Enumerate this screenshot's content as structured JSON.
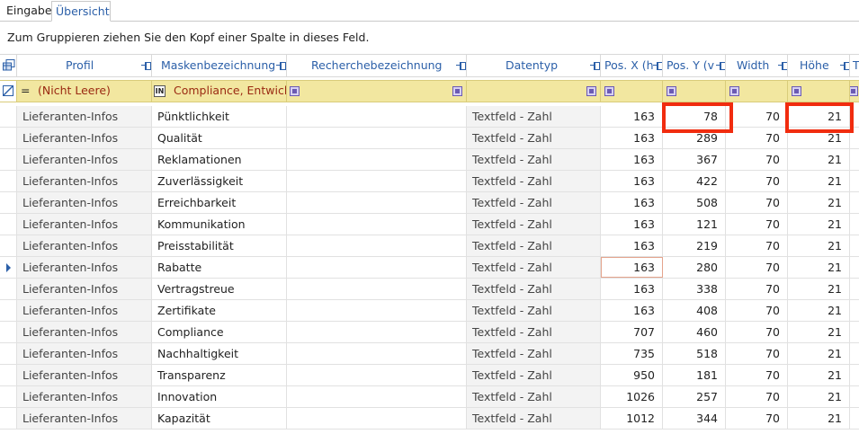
{
  "tabs": [
    {
      "label": "Eingabe",
      "active": false
    },
    {
      "label": "Übersicht",
      "active": true
    }
  ],
  "group_panel": {
    "text": "Zum Gruppieren ziehen Sie den Kopf einer Spalte in dieses Feld."
  },
  "columns": [
    {
      "label": "Profil"
    },
    {
      "label": "Maskenbezeichnung"
    },
    {
      "label": "Recherchebezeichnung"
    },
    {
      "label": "Datentyp"
    },
    {
      "label": "Pos. X (h"
    },
    {
      "label": "Pos. Y (v"
    },
    {
      "label": "Width"
    },
    {
      "label": "Höhe"
    },
    {
      "label": "T"
    }
  ],
  "filter_row": {
    "operator": "=",
    "profil": "(Nicht Leere)",
    "in_label": "IN",
    "maskenbezeichnung": "Compliance, Entwickl"
  },
  "rows": [
    {
      "profil": "Lieferanten-Infos",
      "maske": "Pünktlichkeit",
      "recherche": "",
      "datentyp": "Textfeld - Zahl",
      "x": "163",
      "y": "78",
      "w": "70",
      "h": "21"
    },
    {
      "profil": "Lieferanten-Infos",
      "maske": "Qualität",
      "recherche": "",
      "datentyp": "Textfeld - Zahl",
      "x": "163",
      "y": "289",
      "w": "70",
      "h": "21"
    },
    {
      "profil": "Lieferanten-Infos",
      "maske": "Reklamationen",
      "recherche": "",
      "datentyp": "Textfeld - Zahl",
      "x": "163",
      "y": "367",
      "w": "70",
      "h": "21"
    },
    {
      "profil": "Lieferanten-Infos",
      "maske": "Zuverlässigkeit",
      "recherche": "",
      "datentyp": "Textfeld - Zahl",
      "x": "163",
      "y": "422",
      "w": "70",
      "h": "21"
    },
    {
      "profil": "Lieferanten-Infos",
      "maske": "Erreichbarkeit",
      "recherche": "",
      "datentyp": "Textfeld - Zahl",
      "x": "163",
      "y": "508",
      "w": "70",
      "h": "21"
    },
    {
      "profil": "Lieferanten-Infos",
      "maske": "Kommunikation",
      "recherche": "",
      "datentyp": "Textfeld - Zahl",
      "x": "163",
      "y": "121",
      "w": "70",
      "h": "21"
    },
    {
      "profil": "Lieferanten-Infos",
      "maske": "Preisstabilität",
      "recherche": "",
      "datentyp": "Textfeld - Zahl",
      "x": "163",
      "y": "219",
      "w": "70",
      "h": "21"
    },
    {
      "profil": "Lieferanten-Infos",
      "maske": "Rabatte",
      "recherche": "",
      "datentyp": "Textfeld - Zahl",
      "x": "163",
      "y": "280",
      "w": "70",
      "h": "21",
      "current": true
    },
    {
      "profil": "Lieferanten-Infos",
      "maske": "Vertragstreue",
      "recherche": "",
      "datentyp": "Textfeld - Zahl",
      "x": "163",
      "y": "338",
      "w": "70",
      "h": "21"
    },
    {
      "profil": "Lieferanten-Infos",
      "maske": "Zertifikate",
      "recherche": "",
      "datentyp": "Textfeld - Zahl",
      "x": "163",
      "y": "408",
      "w": "70",
      "h": "21"
    },
    {
      "profil": "Lieferanten-Infos",
      "maske": "Compliance",
      "recherche": "",
      "datentyp": "Textfeld - Zahl",
      "x": "707",
      "y": "460",
      "w": "70",
      "h": "21"
    },
    {
      "profil": "Lieferanten-Infos",
      "maske": "Nachhaltigkeit",
      "recherche": "",
      "datentyp": "Textfeld - Zahl",
      "x": "735",
      "y": "518",
      "w": "70",
      "h": "21"
    },
    {
      "profil": "Lieferanten-Infos",
      "maske": "Transparenz",
      "recherche": "",
      "datentyp": "Textfeld - Zahl",
      "x": "950",
      "y": "181",
      "w": "70",
      "h": "21"
    },
    {
      "profil": "Lieferanten-Infos",
      "maske": "Innovation",
      "recherche": "",
      "datentyp": "Textfeld - Zahl",
      "x": "1026",
      "y": "257",
      "w": "70",
      "h": "21"
    },
    {
      "profil": "Lieferanten-Infos",
      "maske": "Kapazität",
      "recherche": "",
      "datentyp": "Textfeld - Zahl",
      "x": "1012",
      "y": "344",
      "w": "70",
      "h": "21"
    }
  ],
  "colors": {
    "accent_blue": "#2b5fa8",
    "filter_bg": "#f2e7a0",
    "filter_text": "#9a2a12",
    "highlight_red": "#f12c0f"
  }
}
